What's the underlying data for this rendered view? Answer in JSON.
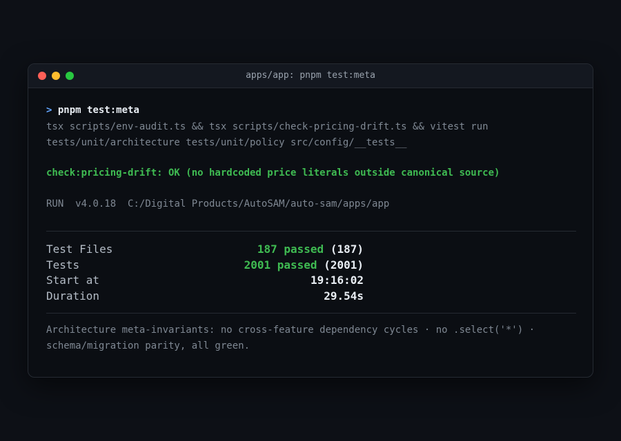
{
  "window": {
    "title": "apps/app: pnpm test:meta"
  },
  "terminal": {
    "prompt_symbol": ">",
    "command": "pnpm test:meta",
    "script_line_1": "tsx scripts/env-audit.ts && tsx scripts/check-pricing-drift.ts && vitest run",
    "script_line_2": "tests/unit/architecture tests/unit/policy src/config/__tests__",
    "check_result": "check:pricing-drift: OK (no hardcoded price literals outside canonical source)",
    "run_label": "RUN",
    "run_version": "v4.0.18",
    "run_path": "C:/Digital Products/AutoSAM/auto-sam/apps/app"
  },
  "summary": {
    "rows": [
      {
        "label": "Test Files",
        "value": "187 passed",
        "extra": "(187)"
      },
      {
        "label": "Tests",
        "value": "2001 passed",
        "extra": "(2001)"
      },
      {
        "label": "Start at",
        "value": "",
        "extra": "19:16:02"
      },
      {
        "label": "Duration",
        "value": "",
        "extra": "29.54s"
      }
    ]
  },
  "note": "Architecture meta-invariants: no cross-feature dependency cycles · no .select('*') · schema/migration parity, all green.",
  "colors": {
    "background": "#0d1016",
    "window": "#0b0e13",
    "titlebar": "#141820",
    "success": "#3fbb52",
    "prompt": "#63a6ff",
    "muted": "#7f8893"
  }
}
